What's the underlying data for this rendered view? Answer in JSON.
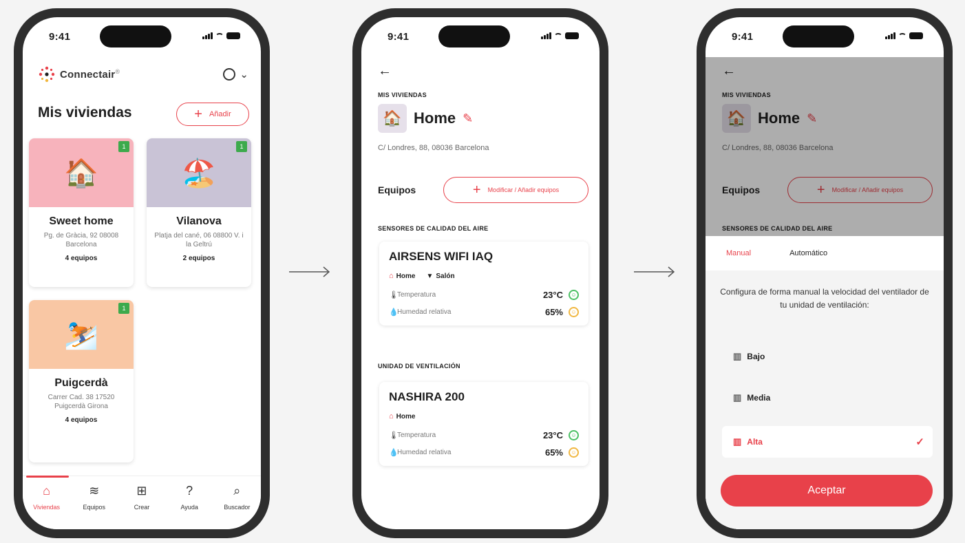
{
  "status": {
    "time": "9:41"
  },
  "screen1": {
    "brand": "Connectair",
    "brand_mark": "®",
    "title": "Mis viviendas",
    "add_label": "Añadir",
    "homes": [
      {
        "name": "Sweet home",
        "address": "Pg. de Gràcia, 92 08008 Barcelona",
        "count": "4 equipos",
        "badge": "1",
        "emoji": "🏠",
        "color": "#f7b3bc"
      },
      {
        "name": "Vilanova",
        "address": "Platja del cané, 06 08800 V. i la Geltrú",
        "count": "2 equipos",
        "badge": "1",
        "emoji": "🏖️",
        "color": "#c9c3d6"
      },
      {
        "name": "Puigcerdà",
        "address": "Carrer Cad. 38 17520 Puigcerdà Girona",
        "count": "4 equipos",
        "badge": "1",
        "emoji": "⛷️",
        "color": "#f9c7a4"
      }
    ],
    "tabs": [
      {
        "label": "Viviendas",
        "icon": "⌂"
      },
      {
        "label": "Equipos",
        "icon": "≋"
      },
      {
        "label": "Crear",
        "icon": "⊞"
      },
      {
        "label": "Ayuda",
        "icon": "?"
      },
      {
        "label": "Buscador",
        "icon": "⌕"
      }
    ]
  },
  "screen2": {
    "section_homes": "MIS VIVIENDAS",
    "home_title": "Home",
    "address": "C/ Londres, 88, 08036 Barcelona",
    "equipos_label": "Equipos",
    "modify_label": "Modificar / Añadir equipos",
    "section_air": "SENSORES DE CALIDAD DEL AIRE",
    "section_vent": "UNIDAD DE VENTILACIÓN",
    "device1": {
      "name": "AIRSENS WIFI IAQ",
      "chip_home": "Home",
      "chip_room": "Salón",
      "temp_label": "Temperatura",
      "temp_value": "23°C",
      "hum_label": "Humedad relativa",
      "hum_value": "65%"
    },
    "device2": {
      "name": "NASHIRA 200",
      "chip_home": "Home",
      "temp_label": "Temperatura",
      "temp_value": "23°C",
      "hum_label": "Humedad relativa",
      "hum_value": "65%"
    }
  },
  "screen3": {
    "tab_manual": "Manual",
    "tab_auto": "Automático",
    "description": "Configura de forma manual la velocidad del ventilador de tu unidad de ventilación:",
    "options": [
      "Bajo",
      "Media",
      "Alta"
    ],
    "selected": "Alta",
    "accept_label": "Aceptar"
  },
  "colors": {
    "accent": "#e8414a",
    "badge": "#3daa4c",
    "good": "#4cc064",
    "warn": "#f1b740"
  }
}
